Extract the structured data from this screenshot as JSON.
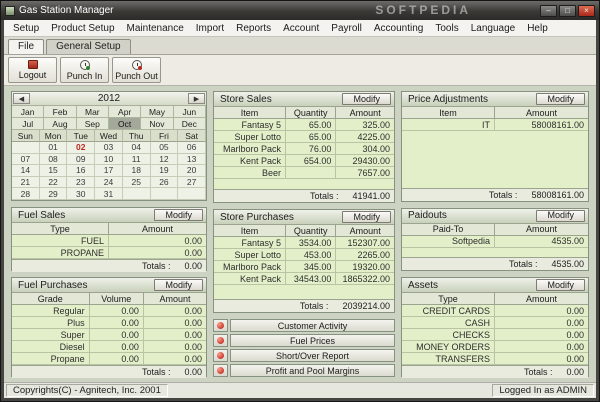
{
  "window": {
    "title": "Gas Station Manager",
    "watermark": "SOFTPEDIA"
  },
  "menu": [
    "Setup",
    "Product Setup",
    "Maintenance",
    "Import",
    "Reports",
    "Account",
    "Payroll",
    "Accounting",
    "Tools",
    "Language",
    "Help"
  ],
  "tabs": [
    "File",
    "General Setup"
  ],
  "toolbar": [
    {
      "label": "Logout"
    },
    {
      "label": "Punch In"
    },
    {
      "label": "Punch Out"
    }
  ],
  "labels": {
    "modify": "Modify",
    "totals": "Totals :"
  },
  "calendar": {
    "year": "2012",
    "prev_icon": "◀",
    "next_icon": "▶",
    "months": [
      "Jan",
      "Feb",
      "Mar",
      "Apr",
      "May",
      "Jun",
      "Jul",
      "Aug",
      "Sep",
      "Oct",
      "Nov",
      "Dec"
    ],
    "selected_month": "Oct",
    "day_headers": [
      "Sun",
      "Mon",
      "Tue",
      "Wed",
      "Thu",
      "Fri",
      "Sat"
    ],
    "weeks": [
      [
        "",
        "01",
        "02",
        "03",
        "04",
        "05",
        "06"
      ],
      [
        "07",
        "08",
        "09",
        "10",
        "11",
        "12",
        "13"
      ],
      [
        "14",
        "15",
        "16",
        "17",
        "18",
        "19",
        "20"
      ],
      [
        "21",
        "22",
        "23",
        "24",
        "25",
        "26",
        "27"
      ],
      [
        "28",
        "29",
        "30",
        "31",
        "",
        "",
        ""
      ]
    ],
    "selected_day": "02"
  },
  "panels": {
    "store_sales": {
      "title": "Store Sales",
      "headers": [
        "Item",
        "Quantity",
        "Amount"
      ],
      "rows": [
        [
          "Fantasy 5",
          "65.00",
          "325.00"
        ],
        [
          "Super Lotto",
          "65.00",
          "4225.00"
        ],
        [
          "Marlboro Pack",
          "76.00",
          "304.00"
        ],
        [
          "Kent Pack",
          "654.00",
          "29430.00"
        ],
        [
          "Beer",
          "",
          "7657.00"
        ]
      ],
      "total": "41941.00"
    },
    "price_adjustments": {
      "title": "Price Adjustments",
      "headers": [
        "Item",
        "Amount"
      ],
      "rows": [
        [
          "IT",
          "58008161.00"
        ]
      ],
      "total": "58008161.00"
    },
    "fuel_sales": {
      "title": "Fuel Sales",
      "headers": [
        "Type",
        "Amount"
      ],
      "rows": [
        [
          "FUEL",
          "0.00"
        ],
        [
          "PROPANE",
          "0.00"
        ]
      ],
      "total": "0.00"
    },
    "store_purchases": {
      "title": "Store Purchases",
      "headers": [
        "Item",
        "Quantity",
        "Amount"
      ],
      "rows": [
        [
          "Fantasy 5",
          "3534.00",
          "152307.00"
        ],
        [
          "Super Lotto",
          "453.00",
          "2265.00"
        ],
        [
          "Marlboro Pack",
          "345.00",
          "19320.00"
        ],
        [
          "Kent Pack",
          "34543.00",
          "1865322.00"
        ]
      ],
      "total": "2039214.00"
    },
    "paidouts": {
      "title": "Paidouts",
      "headers": [
        "Paid-To",
        "Amount"
      ],
      "rows": [
        [
          "Softpedia",
          "4535.00"
        ]
      ],
      "total": "4535.00"
    },
    "fuel_purchases": {
      "title": "Fuel Purchases",
      "headers": [
        "Grade",
        "Volume",
        "Amount"
      ],
      "rows": [
        [
          "Regular",
          "0.00",
          "0.00"
        ],
        [
          "Plus",
          "0.00",
          "0.00"
        ],
        [
          "Super",
          "0.00",
          "0.00"
        ],
        [
          "Diesel",
          "0.00",
          "0.00"
        ],
        [
          "Propane",
          "0.00",
          "0.00"
        ]
      ],
      "total": "0.00"
    },
    "assets": {
      "title": "Assets",
      "headers": [
        "Type",
        "Amount"
      ],
      "rows": [
        [
          "CREDIT CARDS",
          "0.00"
        ],
        [
          "CASH",
          "0.00"
        ],
        [
          "CHECKS",
          "0.00"
        ],
        [
          "MONEY ORDERS",
          "0.00"
        ],
        [
          "TRANSFERS",
          "0.00"
        ]
      ],
      "total": "0.00"
    }
  },
  "action_buttons": [
    "Customer Activity",
    "Fuel Prices",
    "Short/Over Report",
    "Profit and Pool Margins"
  ],
  "status": {
    "left": "Copyrights(C) - Agnitech, Inc. 2001",
    "right": "Logged In as ADMIN"
  },
  "colors": {
    "accent_red": "#b3281e",
    "table_row_green": "#e3efc9",
    "selected_month_gray": "#a2a99a",
    "panel_border": "#87917f"
  }
}
